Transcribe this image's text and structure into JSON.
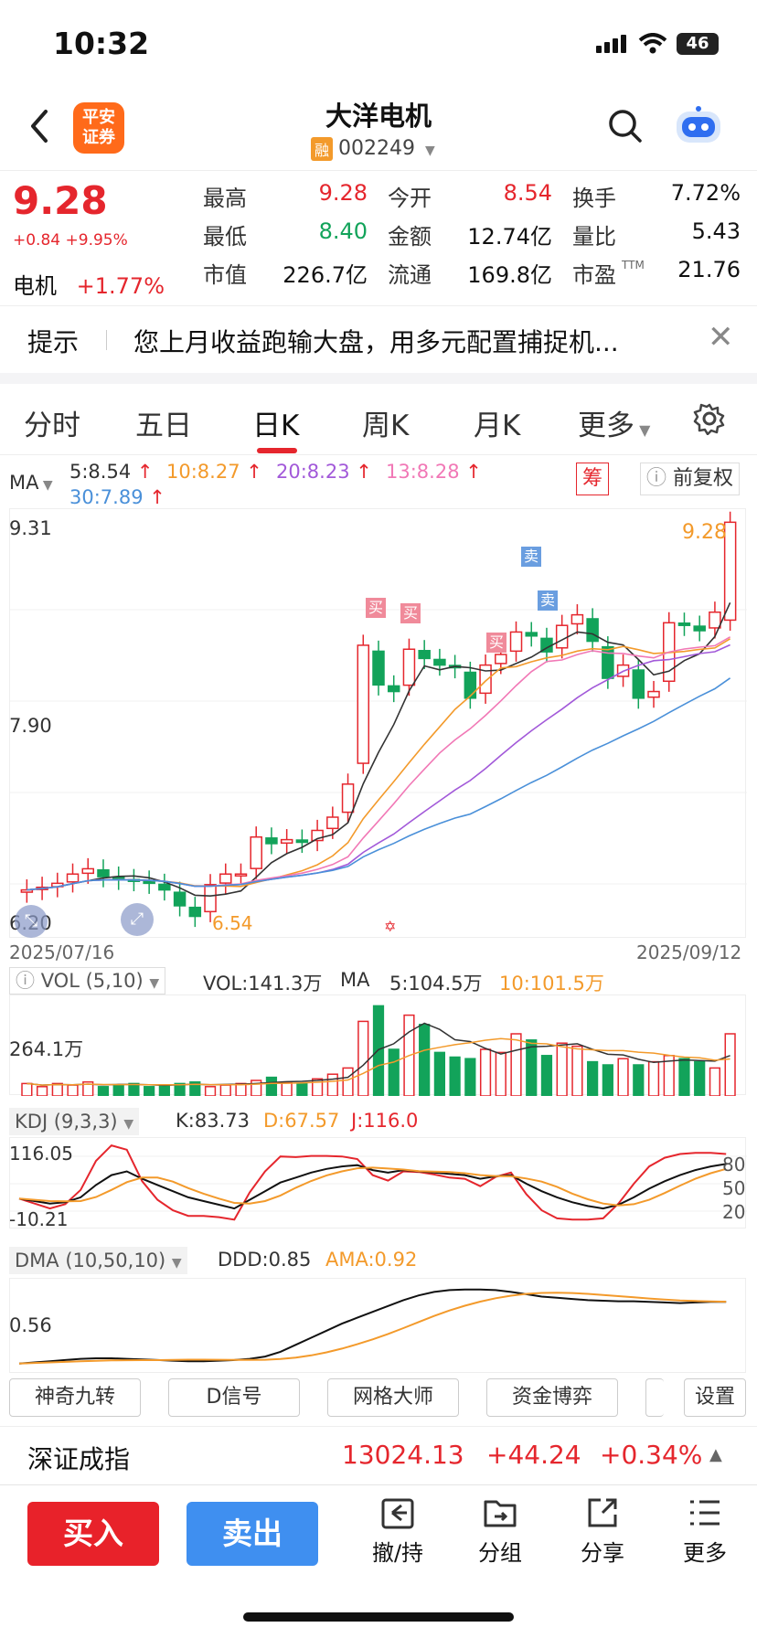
{
  "status": {
    "time": "10:32",
    "battery": "46"
  },
  "nav": {
    "title": "大洋电机",
    "rong_badge": "融",
    "code": "002249",
    "logo_line1": "平安",
    "logo_line2": "证券"
  },
  "quote": {
    "price": "9.28",
    "change": "+0.84",
    "change_pct": "+9.95%",
    "sector_name": "电机",
    "sector_pct": "+1.77%",
    "cells": [
      {
        "label": "最高",
        "value": "9.28"
      },
      {
        "label": "今开",
        "value": "8.54"
      },
      {
        "label": "换手",
        "value": "7.72%"
      },
      {
        "label": "最低",
        "value": "8.40"
      },
      {
        "label": "金额",
        "value": "12.74亿"
      },
      {
        "label": "量比",
        "value": "5.43"
      },
      {
        "label": "市值",
        "value": "226.7亿"
      },
      {
        "label": "流通",
        "value": "169.8亿"
      },
      {
        "label": "市盈",
        "value": "21.76"
      }
    ],
    "ttm": "TTM"
  },
  "tip": {
    "label": "提示",
    "text": "您上月收益跑输大盘，用多元配置捕捉机..."
  },
  "tabs": [
    "分时",
    "五日",
    "日K",
    "周K",
    "月K",
    "更多"
  ],
  "ma_legend": {
    "label": "MA",
    "items": [
      {
        "text": "5:8.54",
        "color": "#333333"
      },
      {
        "text": "10:8.27",
        "color": "#f39a2b"
      },
      {
        "text": "20:8.23",
        "color": "#a259d9"
      },
      {
        "text": "13:8.28",
        "color": "#f178b6"
      },
      {
        "text": "30:7.89",
        "color": "#4a90d9"
      }
    ],
    "chou": "筹",
    "fuquan": "前复权"
  },
  "kline": {
    "y_high": "9.31",
    "y_mid": "7.90",
    "y_low": "6.20",
    "date_start": "2025/07/16",
    "date_end": "2025/09/12",
    "last_price": "9.28",
    "low_label": "6.54",
    "buy_tag": "买",
    "sell_tag": "卖"
  },
  "chart_data": {
    "type": "candlestick",
    "x": [
      "2025/07/16",
      "2025/09/12"
    ],
    "ylim": [
      6.2,
      9.31
    ],
    "closes_approx": [
      6.5,
      6.52,
      6.55,
      6.62,
      6.66,
      6.6,
      6.58,
      6.57,
      6.55,
      6.5,
      6.38,
      6.3,
      6.54,
      6.62,
      6.62,
      6.9,
      6.85,
      6.88,
      6.86,
      6.95,
      7.05,
      7.3,
      8.35,
      8.05,
      8.0,
      8.32,
      8.25,
      8.2,
      8.18,
      7.95,
      8.2,
      8.28,
      8.45,
      8.42,
      8.3,
      8.5,
      8.58,
      8.38,
      8.1,
      8.2,
      7.95,
      8.0,
      8.52,
      8.5,
      8.46,
      8.6,
      9.28
    ],
    "vol": {
      "label": "VOL (5,10)",
      "vol": "VOL:141.3万",
      "ma_label": "MA",
      "ma5": "5:104.5万",
      "ma10": "10:101.5万",
      "y": "264.1万"
    },
    "kdj": {
      "label": "KDJ (9,3,3)",
      "k": "K:83.73",
      "d": "D:67.57",
      "j": "J:116.0",
      "ytop": "116.05",
      "ybot": "-10.21",
      "levels": [
        "80",
        "50",
        "20"
      ]
    },
    "dma": {
      "label": "DMA (10,50,10)",
      "ddd": "DDD:0.85",
      "ama": "AMA:0.92",
      "y": "0.56"
    }
  },
  "tools": [
    "神奇九转",
    "D信号",
    "网格大师",
    "资金博弈",
    "设置"
  ],
  "index": {
    "name": "深证成指",
    "value": "13024.13",
    "change": "+44.24",
    "pct": "+0.34%"
  },
  "bottom": {
    "buy": "买入",
    "sell": "卖出",
    "actions": [
      "撤/持",
      "分组",
      "分享",
      "更多"
    ]
  },
  "colors": {
    "up": "#e5262d",
    "down": "#12a35a",
    "accent": "#f39a2b"
  }
}
